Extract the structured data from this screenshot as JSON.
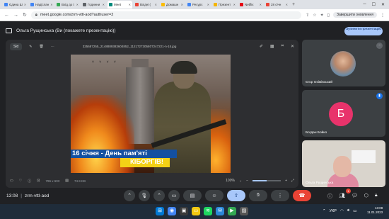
{
  "browser": {
    "tabs": [
      {
        "label": "Єдина Ш",
        "color": "#4285f4",
        "active": false
      },
      {
        "label": "Надіслан",
        "color": "#4285f4",
        "active": false
      },
      {
        "label": "Вхід до t",
        "color": "#34a853",
        "active": false
      },
      {
        "label": "Годинни",
        "color": "#5f6368",
        "active": false
      },
      {
        "label": "Meet",
        "color": "#00897b",
        "active": true
      },
      {
        "label": "Вхідні (",
        "color": "#ea4335",
        "active": false
      },
      {
        "label": "Домашн",
        "color": "#fbbc04",
        "active": false
      },
      {
        "label": "Ресурс",
        "color": "#4285f4",
        "active": false
      },
      {
        "label": "Презент",
        "color": "#f4b400",
        "active": false
      },
      {
        "label": "Netflix",
        "color": "#e50914",
        "active": false
      },
      {
        "label": "28 січн",
        "color": "#ea4335",
        "active": false
      }
    ],
    "new_tab": "+",
    "url": "meet.google.com/zrm-vttl-aod?authuser=2",
    "profile_button": "Завершити оновлення"
  },
  "meet": {
    "presenter_banner": "Ольга Рущинська (Ви (покажете презентацію))",
    "stop_button": "Зупинити презентацію",
    "stage": {
      "chip": "Sld",
      "filename": "325687255_2148889383604852_1121727305807247221-n-15.jpg",
      "slide_caption_1": "16 січня - День пам'яті",
      "slide_caption_2": "КІБОРГІВ!",
      "size_info": "796 x 603",
      "file_size": "74.9 KB",
      "zoom": "100%",
      "zoom_level": 0.5
    },
    "participants": [
      {
        "name": "Єгор Охімівський"
      },
      {
        "name": "Богдан Бойко",
        "initial": "Б",
        "avatar_color": "#e8336b"
      },
      {
        "name": "Ольга Рущинська"
      }
    ],
    "meeting_time": "13:08",
    "meeting_code": "zrm-vttl-aod",
    "notification_count": "1"
  },
  "taskbar": {
    "language": "УКР",
    "time": "13:08",
    "date": "11.01.2023"
  }
}
